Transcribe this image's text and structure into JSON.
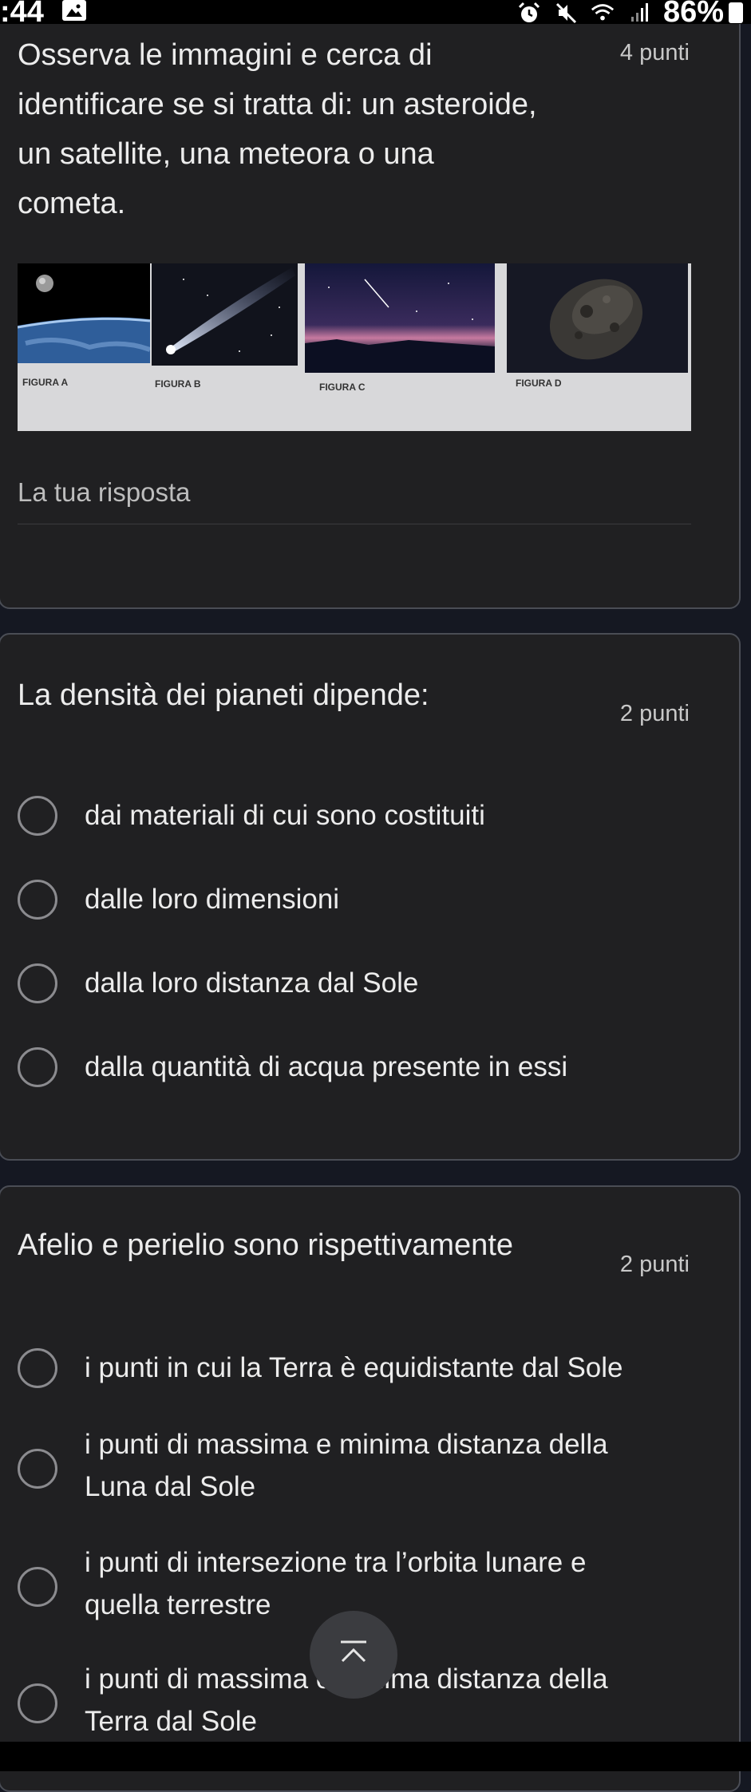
{
  "status_bar": {
    "time": ":44",
    "battery": "86%"
  },
  "q1": {
    "lines": [
      "Osserva le immagini e cerca di",
      "identificare se si tratta di: un asteroide,",
      "un satellite, una meteora o una",
      "cometa."
    ],
    "points": "4 punti",
    "figure_labels": [
      "FIGURA A",
      "FIGURA B",
      "FIGURA C",
      "FIGURA D"
    ],
    "answer_placeholder": "La tua risposta"
  },
  "q2": {
    "title": "La densità dei pianeti dipende:",
    "points": "2 punti",
    "options": [
      "dai materiali di cui sono costituiti",
      "dalle loro dimensioni",
      "dalla loro distanza dal Sole",
      "dalla quantità di acqua presente in essi"
    ]
  },
  "q3": {
    "title": "Afelio e perielio sono rispettivamente",
    "points": "2 punti",
    "options": [
      {
        "line1": "i punti in cui la Terra è equidistante dal Sole",
        "line2": ""
      },
      {
        "line1": "i punti di massima e minima distanza della",
        "line2": "Luna dal Sole"
      },
      {
        "line1": "i punti di intersezione tra l’orbita lunare e",
        "line2": "quella terrestre"
      },
      {
        "line1": "i punti di massima e minima distanza della",
        "line2": "Terra dal Sole"
      }
    ]
  },
  "icons": {
    "scroll_top": "chevron-up-icon",
    "status": [
      "gallery-icon",
      "alarm-icon",
      "mute-icon",
      "wifi-icon",
      "signal-icon",
      "battery-icon"
    ]
  },
  "colors": {
    "card_bg": "#202022",
    "page_bg": "#151822",
    "card_border": "#4a4d55"
  }
}
